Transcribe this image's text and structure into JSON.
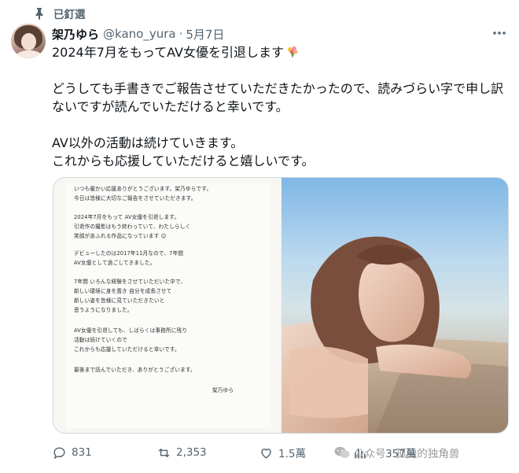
{
  "pinned": {
    "label": "已釘選"
  },
  "author": {
    "name": "架乃ゆら",
    "handle": "@kano_yura",
    "separator": "·",
    "date": "5月7日"
  },
  "tweet": {
    "paragraphs": [
      "2024年7月をもってAV女優を引退します",
      "どうしても手書きでご報告させていただきたかったので、読みづらい字で申し訳ないですが読んでいただけると幸いです。",
      "AV以外の活動は続けていきます。\nこれからも応援していただけると嬉しいです。"
    ],
    "emoji_icon": "bouquet-icon"
  },
  "letter_lines": [
    "いつも暖かい応援ありがとうございます。架乃ゆらです。",
    "今日は皆様に大切なご報告をさせていただきます。",
    "2024年7月をもって AV女優を引退します。",
    "引退作の撮影はもう終わっていて、わたしらしく",
    "笑顔があふれる作品になっています ☺",
    "デビューしたのは2017年11月なので、7年間",
    "AV女優として過ごしてきました。",
    "7年間 いろんな経験をさせていただいた中で、",
    "新しい環境に身を置き 自分を成長させて",
    "新しい姿を皆様に見ていただきたいと",
    "思うようになりました。",
    "AV女優を引退しても、しばらくは事務所に残り",
    "活動は続けていくので",
    "これからも応援していただけると幸いです。",
    "最後まで読んでいただき、ありがとうございます。",
    "架乃ゆら"
  ],
  "stats": {
    "replies": "831",
    "reposts": "2,353",
    "likes": "1.5萬",
    "views": "357萬"
  },
  "watermark": {
    "text": "公众号 · 孤独的独角兽",
    "icon": "wechat-icon"
  },
  "colors": {
    "text": "#0f1419",
    "secondary": "#536471",
    "border": "#cfd9de"
  }
}
